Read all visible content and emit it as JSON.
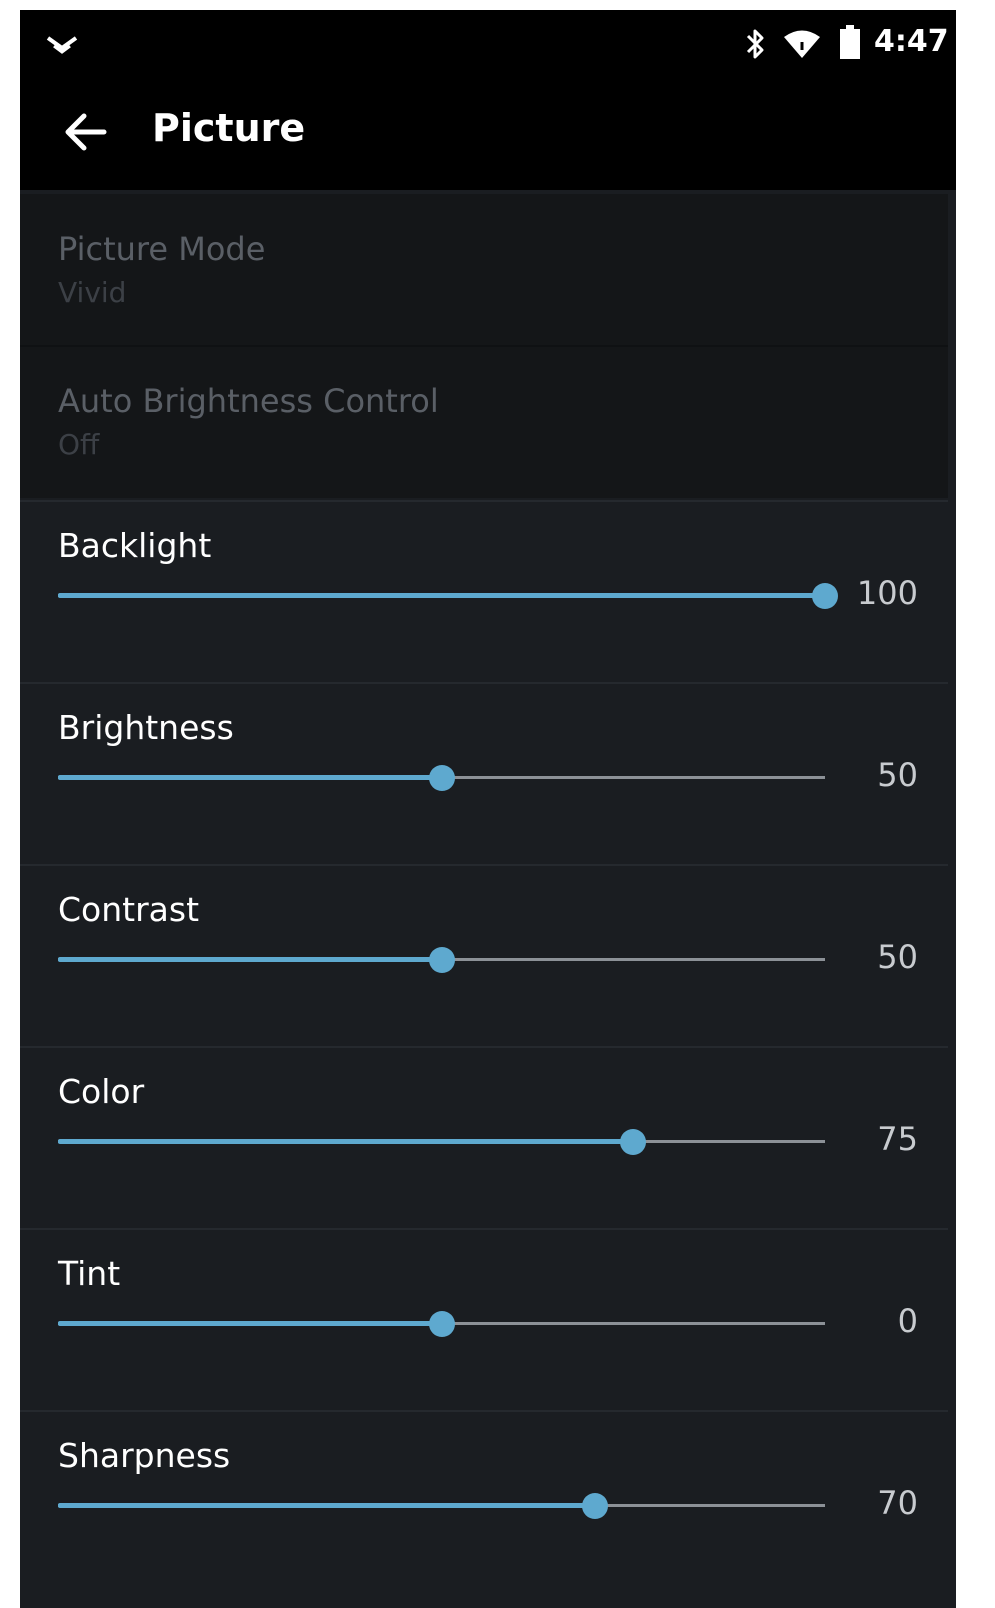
{
  "status_bar": {
    "time": "4:47",
    "icons": [
      "dropdown-icon",
      "bluetooth-icon",
      "wifi-icon",
      "battery-icon"
    ]
  },
  "app_bar": {
    "title": "Picture",
    "back_icon": "arrow-left-icon"
  },
  "disabled_settings": [
    {
      "title": "Picture Mode",
      "value": "Vivid"
    },
    {
      "title": "Auto Brightness Control",
      "value": "Off"
    }
  ],
  "sliders": [
    {
      "label": "Backlight",
      "value": "100",
      "fraction": 1.0
    },
    {
      "label": "Brightness",
      "value": "50",
      "fraction": 0.5
    },
    {
      "label": "Contrast",
      "value": "50",
      "fraction": 0.5
    },
    {
      "label": "Color",
      "value": "75",
      "fraction": 0.75
    },
    {
      "label": "Tint",
      "value": "0",
      "fraction": 0.5
    },
    {
      "label": "Sharpness",
      "value": "70",
      "fraction": 0.7
    }
  ],
  "colors": {
    "accent": "#5ea9cf",
    "background": "#1a1d21",
    "header": "#000000",
    "disabled_background": "#141618"
  }
}
